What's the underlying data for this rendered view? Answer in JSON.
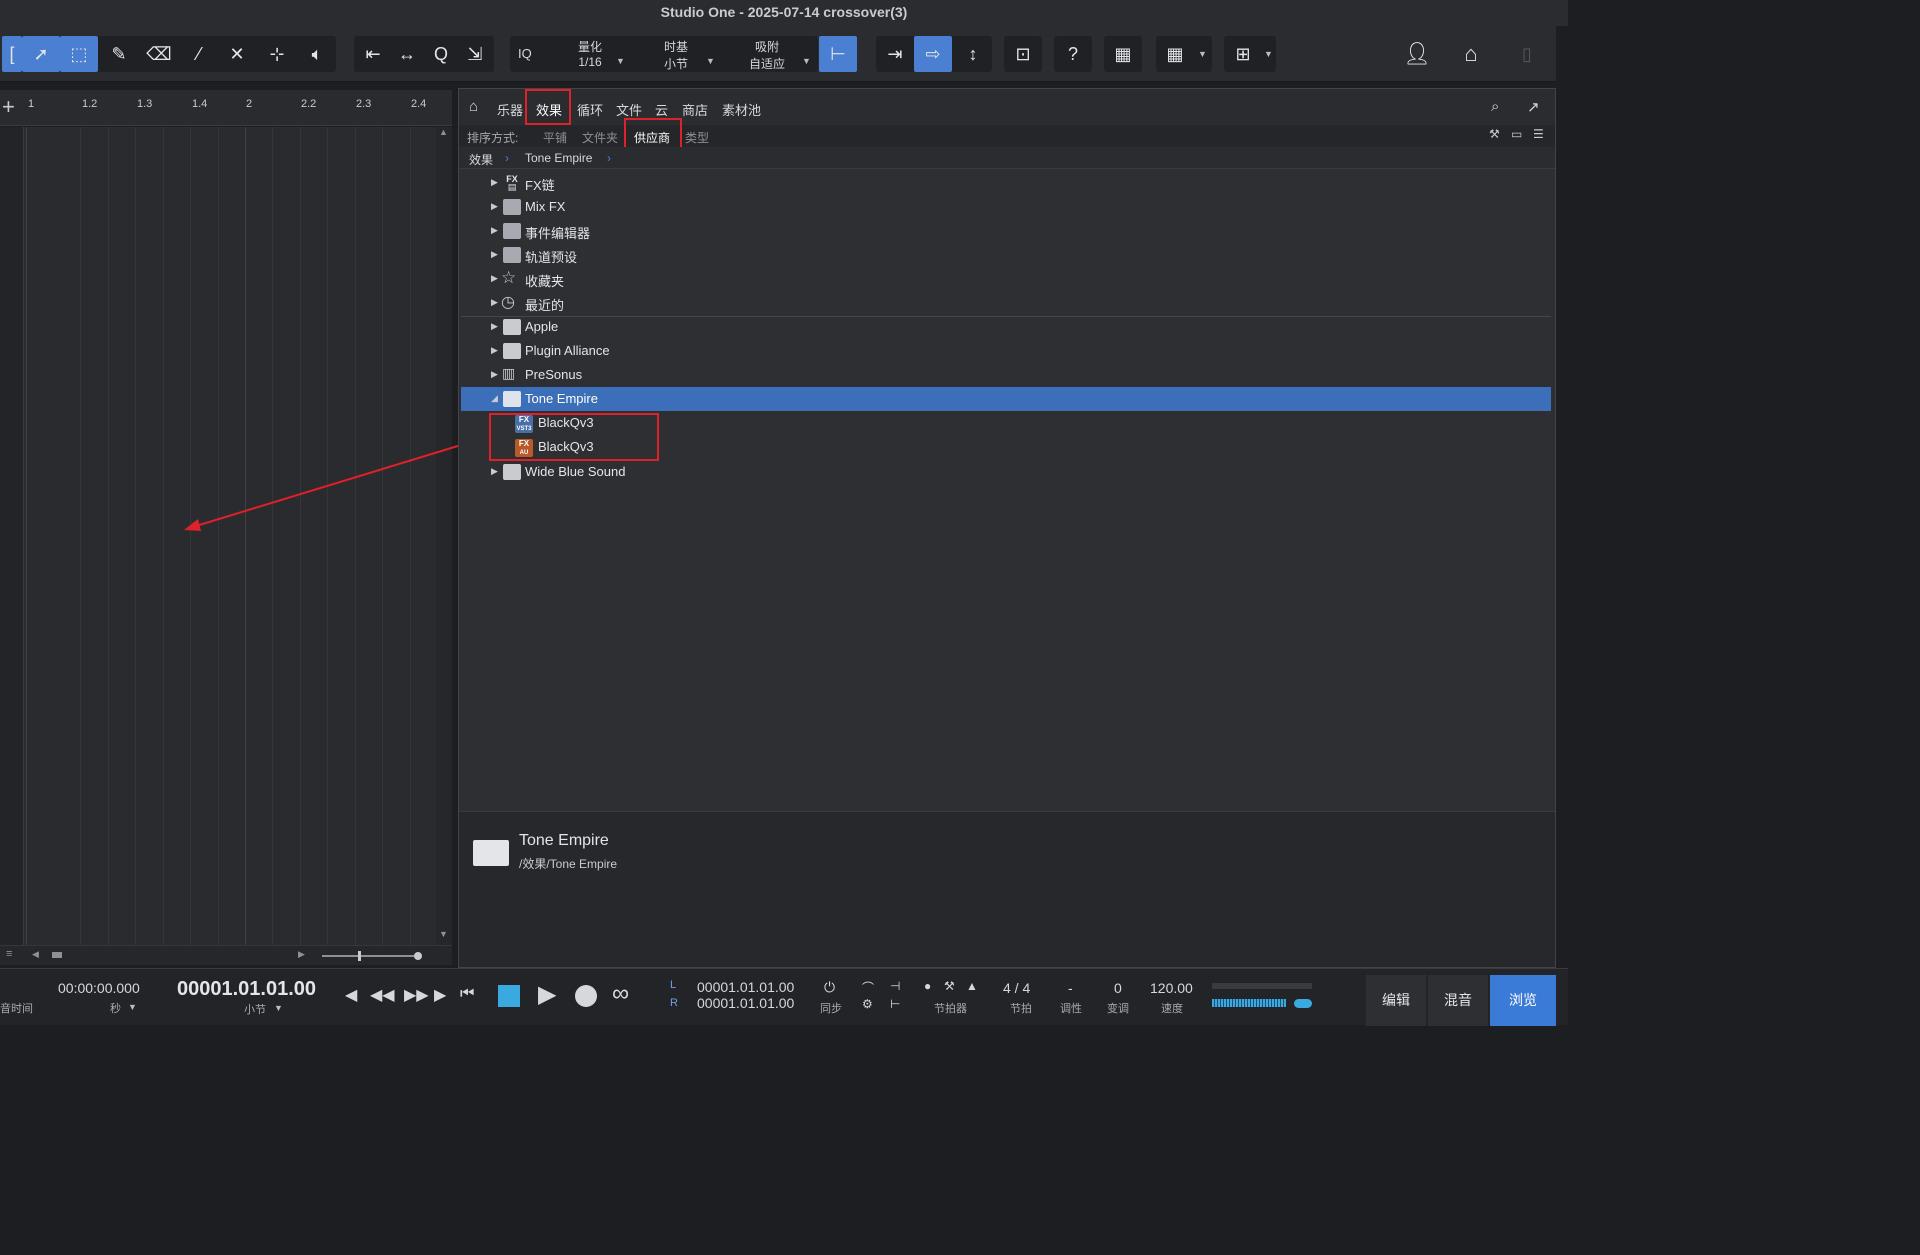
{
  "window": {
    "title": "Studio One - 2025-07-14 crossover(3)"
  },
  "toolbar": {
    "quantize": {
      "label": "量化",
      "value": "1/16"
    },
    "timebase": {
      "label": "时基",
      "value": "小节"
    },
    "snap": {
      "label": "吸附",
      "value": "自适应"
    },
    "iq_label": "IQ",
    "help_label": "?"
  },
  "ruler": {
    "ticks": [
      "1",
      "1.2",
      "1.3",
      "1.4",
      "2",
      "2.2",
      "2.3",
      "2.4"
    ]
  },
  "browser": {
    "tabs": [
      "乐器",
      "效果",
      "循环",
      "文件",
      "云",
      "商店",
      "素材池"
    ],
    "sort": {
      "label": "排序方式:",
      "options": [
        "平铺",
        "文件夹",
        "供应商",
        "类型"
      ]
    },
    "breadcrumb": [
      "效果",
      "Tone Empire"
    ],
    "tree": [
      {
        "label": "FX链",
        "icon": "fx-chain-icon"
      },
      {
        "label": "Mix FX",
        "icon": "mixfx-icon"
      },
      {
        "label": "事件编辑器",
        "icon": "event-editor-icon"
      },
      {
        "label": "轨道预设",
        "icon": "track-preset-icon"
      },
      {
        "label": "收藏夹",
        "icon": "star-icon"
      },
      {
        "label": "最近的",
        "icon": "clock-icon"
      },
      {
        "label": "Apple",
        "icon": "folder-icon"
      },
      {
        "label": "Plugin Alliance",
        "icon": "folder-icon"
      },
      {
        "label": "PreSonus",
        "icon": "presonus-icon"
      },
      {
        "label": "Tone Empire",
        "icon": "folder-open-icon",
        "selected": true
      },
      {
        "label": "BlackQv3",
        "icon": "fx-vst3-icon",
        "badge": "VST3"
      },
      {
        "label": "BlackQv3",
        "icon": "fx-au-icon",
        "badge": "AU"
      },
      {
        "label": "Wide Blue Sound",
        "icon": "folder-icon"
      }
    ],
    "info": {
      "title": "Tone Empire",
      "path": "/效果/Tone Empire"
    }
  },
  "transport": {
    "time_seconds": "00:00:00.000",
    "time_seconds_unit": "秒",
    "time_label_left": "音时间",
    "position": "00001.01.01.00",
    "position_unit": "小节",
    "loop_L": "00001.01.01.00",
    "loop_R": "00001.01.01.00",
    "L": "L",
    "R": "R",
    "sync_label": "同步",
    "metronome_label": "节拍器",
    "signature": "4 / 4",
    "signature_label": "节拍",
    "key": "-",
    "key_label": "调性",
    "transpose": "0",
    "transpose_label": "变调",
    "tempo": "120.00",
    "tempo_label": "速度",
    "views": [
      "编辑",
      "混音",
      "浏览"
    ]
  },
  "colors": {
    "accent": "#3c6fb9",
    "highlight_box": "#e0202a",
    "annotation_arrow": "#e0202a"
  }
}
